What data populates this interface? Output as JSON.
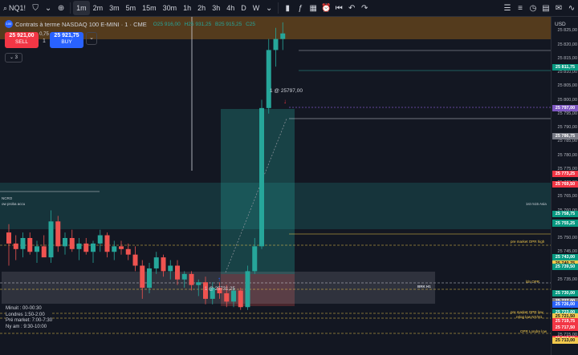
{
  "toolbar": {
    "symbol": "NQ1!",
    "intervals": [
      "1m",
      "2m",
      "3m",
      "5m",
      "15m",
      "30m",
      "1h",
      "2h",
      "3h",
      "4h",
      "D",
      "W"
    ],
    "active_interval": "1m",
    "currency": "USD"
  },
  "header": {
    "logo": "100",
    "title": "Contrats à terme NASDAQ 100 E-MINI · 1 · CME",
    "open": "O25 916,00",
    "high": "H25 931,25",
    "low": "B25 915,25",
    "close": "C25"
  },
  "trade": {
    "sell_price": "25 921,00",
    "sell_label": "SELL",
    "spread": "0,75",
    "qty": "1",
    "buy_price": "25 921,75",
    "buy_label": "BUY"
  },
  "layers_count": "3",
  "annotations": {
    "entry": "1 @ 25797,00",
    "exit": "1 @ 25731,25",
    "left1": "NCRO",
    "left2": "ow proba accu",
    "asia": "1st m15 Asia",
    "brk": "BRK H1"
  },
  "levels": {
    "pm_high": "pre market OPR high",
    "ldn": "ldn OPR",
    "pm_low": "pre market OPR low",
    "ny_low": "relog low NY/H1",
    "opr_ldn": "OPR Londre low"
  },
  "sessions": {
    "s1": "Minuit : 00-00:30",
    "s2": "Londres 1:50-2:00",
    "s3": "Pré market: 7:00-7:30",
    "s4": "Ny am : 9:30-10:00"
  },
  "price_axis": {
    "ticks": [
      "25 825,00",
      "25 820,00",
      "25 815,00",
      "25 810,00",
      "25 805,00",
      "25 800,00",
      "25 795,00",
      "25 790,00",
      "25 785,00",
      "25 780,00",
      "25 775,00",
      "25 770,00",
      "25 765,00",
      "25 760,00",
      "25 755,00",
      "25 750,00",
      "25 745,00",
      "25 740,00",
      "25 735,00",
      "25 730,00",
      "25 725,00",
      "25 720,00",
      "25 715,00"
    ],
    "badges": [
      {
        "v": "25 811,75",
        "c": "#089981"
      },
      {
        "v": "25 797,00",
        "c": "#089981"
      },
      {
        "v": "25 797,00",
        "c": "#7e57c2"
      },
      {
        "v": "25 786,75",
        "c": "#787b86"
      },
      {
        "v": "25 773,25",
        "c": "#f23645"
      },
      {
        "v": "25 769,50",
        "c": "#f23645"
      },
      {
        "v": "25 758,75",
        "c": "#089981"
      },
      {
        "v": "25 755,50",
        "c": "#089981"
      },
      {
        "v": "25 755,25",
        "c": "#089981"
      },
      {
        "v": "25 743,00",
        "c": "#f2c94c"
      },
      {
        "v": "25 743,00",
        "c": "#089981"
      },
      {
        "v": "25 740,75",
        "c": "#f2c94c"
      },
      {
        "v": "25 739,50",
        "c": "#089981"
      },
      {
        "v": "25 730,00",
        "c": "#089981"
      },
      {
        "v": "25 727,00",
        "c": "#787b86"
      },
      {
        "v": "25 726,00",
        "c": "#2962ff"
      },
      {
        "v": "25 723,00",
        "c": "#089981"
      },
      {
        "v": "25 721,50",
        "c": "#f2c94c"
      },
      {
        "v": "25 719,75",
        "c": "#f23645"
      },
      {
        "v": "25 717,50",
        "c": "#f23645"
      },
      {
        "v": "25 713,50",
        "c": "#f23645"
      },
      {
        "v": "25 713,00",
        "c": "#f2c94c"
      }
    ]
  },
  "colors": {
    "up": "#26a69a",
    "down": "#ef5350",
    "bg": "#131722"
  },
  "candles": [
    [
      25752,
      25755,
      25740,
      25748
    ],
    [
      25748,
      25751,
      25742,
      25746
    ],
    [
      25746,
      25752,
      25743,
      25750
    ],
    [
      25750,
      25752,
      25744,
      25745
    ],
    [
      25745,
      25749,
      25741,
      25747
    ],
    [
      25747,
      25751,
      25744,
      25743
    ],
    [
      25743,
      25760,
      25741,
      25756
    ],
    [
      25756,
      25758,
      25745,
      25747
    ],
    [
      25747,
      25752,
      25744,
      25750
    ],
    [
      25750,
      25753,
      25745,
      25746
    ],
    [
      25746,
      25750,
      25742,
      25748
    ],
    [
      25748,
      25750,
      25744,
      25745
    ],
    [
      25745,
      25749,
      25741,
      25748
    ],
    [
      25748,
      25753,
      25745,
      25751
    ],
    [
      25751,
      25752,
      25743,
      25745
    ],
    [
      25745,
      25749,
      25742,
      25747
    ],
    [
      25747,
      25749,
      25744,
      25746
    ],
    [
      25746,
      25748,
      25742,
      25744
    ],
    [
      25744,
      25747,
      25738,
      25740
    ],
    [
      25740,
      25742,
      25728,
      25732
    ],
    [
      25732,
      25741,
      25730,
      25739
    ],
    [
      25739,
      25745,
      25737,
      25743
    ],
    [
      25743,
      25744,
      25736,
      25738
    ],
    [
      25738,
      25742,
      25735,
      25740
    ],
    [
      25740,
      25742,
      25733,
      25735
    ],
    [
      25735,
      25738,
      25732,
      25737
    ],
    [
      25737,
      25738,
      25731,
      25733
    ],
    [
      25733,
      25735,
      25729,
      25734
    ],
    [
      25734,
      25736,
      25726,
      25728
    ],
    [
      25728,
      25734,
      25726,
      25732
    ],
    [
      25732,
      25734,
      25728,
      25730
    ],
    [
      25730,
      25733,
      25725,
      25727
    ],
    [
      25727,
      25732,
      25725,
      25731
    ],
    [
      25731,
      25732,
      25724,
      25725
    ],
    [
      25725,
      25740,
      25724,
      25738
    ],
    [
      25738,
      25750,
      25737,
      25747
    ],
    [
      25747,
      25800,
      25746,
      25797
    ],
    [
      25797,
      25822,
      25795,
      25818
    ],
    [
      25818,
      25826,
      25812,
      25822
    ],
    [
      25822,
      25828,
      25818,
      25824
    ]
  ]
}
